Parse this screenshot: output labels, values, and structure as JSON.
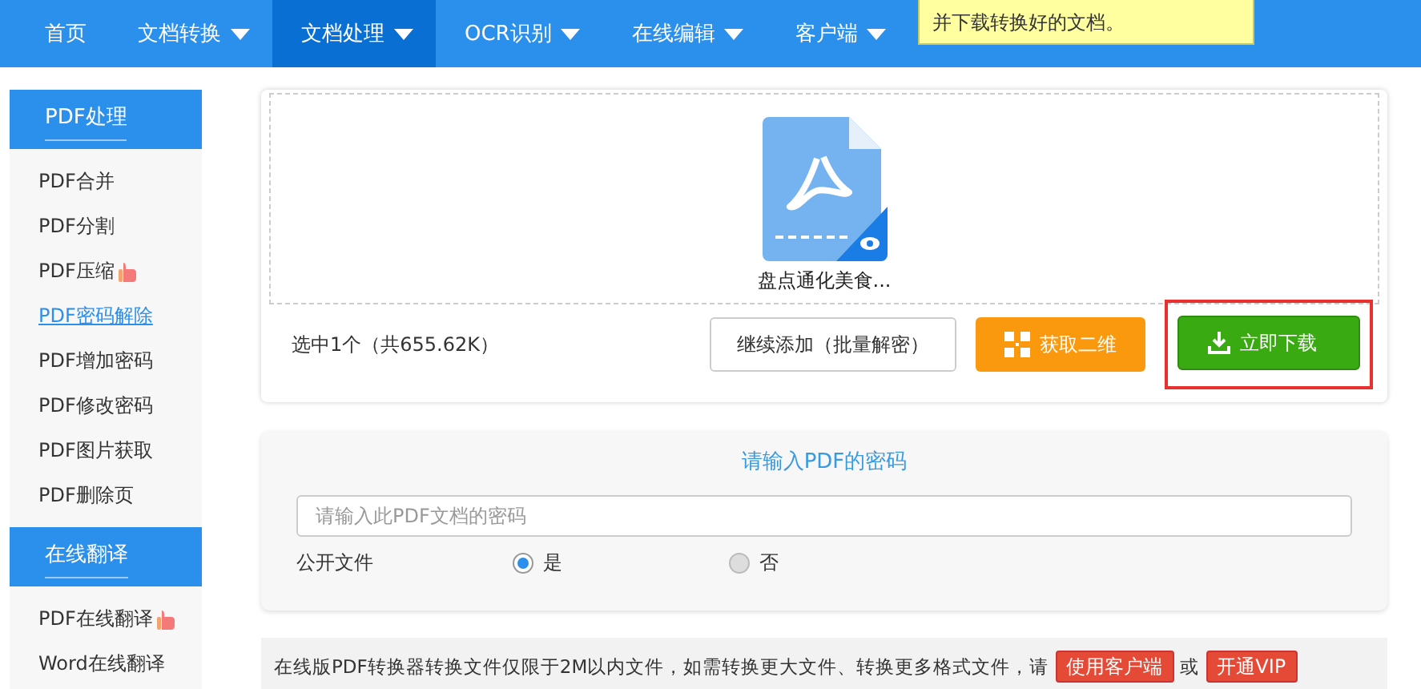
{
  "nav": {
    "items": [
      {
        "label": "首页",
        "dropdown": false,
        "selected": false
      },
      {
        "label": "文档转换",
        "dropdown": true,
        "selected": false
      },
      {
        "label": "文档处理",
        "dropdown": true,
        "selected": true
      },
      {
        "label": "OCR识别",
        "dropdown": true,
        "selected": false
      },
      {
        "label": "在线编辑",
        "dropdown": true,
        "selected": false
      },
      {
        "label": "客户端",
        "dropdown": true,
        "selected": false
      }
    ],
    "tooltip": "并下载转换好的文档。"
  },
  "sidebar": {
    "sections": [
      {
        "title": "PDF处理",
        "items": [
          {
            "label": "PDF合并",
            "hot": false,
            "selected": false
          },
          {
            "label": "PDF分割",
            "hot": false,
            "selected": false
          },
          {
            "label": "PDF压缩",
            "hot": true,
            "selected": false
          },
          {
            "label": "PDF密码解除",
            "hot": false,
            "selected": true
          },
          {
            "label": "PDF增加密码",
            "hot": false,
            "selected": false
          },
          {
            "label": "PDF修改密码",
            "hot": false,
            "selected": false
          },
          {
            "label": "PDF图片获取",
            "hot": false,
            "selected": false
          },
          {
            "label": "PDF删除页",
            "hot": false,
            "selected": false
          }
        ]
      },
      {
        "title": "在线翻译",
        "items": [
          {
            "label": "PDF在线翻译",
            "hot": true,
            "selected": false
          },
          {
            "label": "Word在线翻译",
            "hot": false,
            "selected": false
          }
        ]
      }
    ]
  },
  "file_card": {
    "file_name": "盘点通化美食...",
    "summary": "选中1个（共655.62K）",
    "buttons": [
      {
        "kind": "outline",
        "label": "继续添加（批量解密）",
        "highlighted": false
      },
      {
        "kind": "qr",
        "label": "获取二维",
        "highlighted": false
      },
      {
        "kind": "download",
        "label": "立即下载",
        "highlighted": true
      }
    ]
  },
  "password_card": {
    "title": "请输入PDF的密码",
    "placeholder": "请输入此PDF文档的密码",
    "public_label": "公开文件",
    "options": [
      {
        "label": "是",
        "selected": true
      },
      {
        "label": "否",
        "selected": false
      }
    ]
  },
  "notice": {
    "text": "在线版PDF转换器转换文件仅限于2M以内文件，如需转换更大文件、转换更多格式文件，请",
    "buttons": [
      "使用客户端",
      "开通VIP"
    ],
    "separator": "或"
  }
}
